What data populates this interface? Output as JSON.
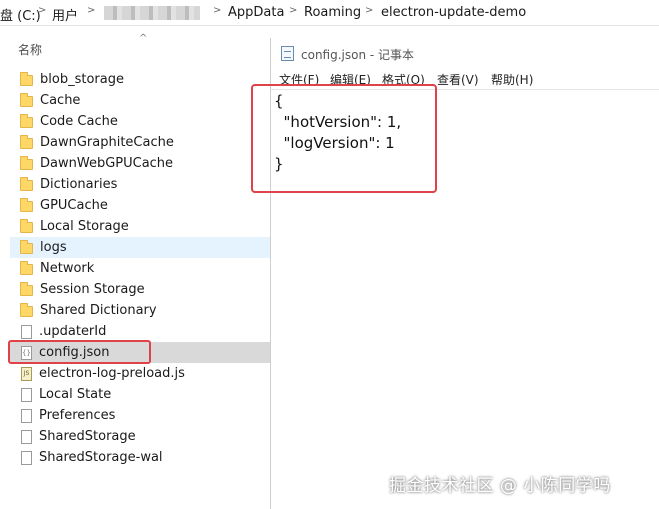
{
  "addressbar": {
    "drive": "盘 (C:)",
    "users": "用户",
    "appdata": "AppData",
    "roaming": "Roaming",
    "folder": "electron-update-demo",
    "separator": ">"
  },
  "explorer": {
    "column_name": "名称",
    "sort_arrow": "^",
    "files": [
      {
        "name": "blob_storage",
        "type": "folder"
      },
      {
        "name": "Cache",
        "type": "folder"
      },
      {
        "name": "Code Cache",
        "type": "folder"
      },
      {
        "name": "DawnGraphiteCache",
        "type": "folder"
      },
      {
        "name": "DawnWebGPUCache",
        "type": "folder"
      },
      {
        "name": "Dictionaries",
        "type": "folder"
      },
      {
        "name": "GPUCache",
        "type": "folder"
      },
      {
        "name": "Local Storage",
        "type": "folder"
      },
      {
        "name": "logs",
        "type": "folder"
      },
      {
        "name": "Network",
        "type": "folder"
      },
      {
        "name": "Session Storage",
        "type": "folder"
      },
      {
        "name": "Shared Dictionary",
        "type": "folder"
      },
      {
        "name": ".updaterId",
        "type": "file"
      },
      {
        "name": "config.json",
        "type": "json"
      },
      {
        "name": "electron-log-preload.js",
        "type": "js"
      },
      {
        "name": "Local State",
        "type": "file"
      },
      {
        "name": "Preferences",
        "type": "file"
      },
      {
        "name": "SharedStorage",
        "type": "file"
      },
      {
        "name": "SharedStorage-wal",
        "type": "file"
      }
    ]
  },
  "notepad": {
    "title": "config.json - 记事本",
    "menu": [
      "文件(F)",
      "编辑(E)",
      "格式(O)",
      "查看(V)",
      "帮助(H)"
    ],
    "content_lines": [
      "{",
      "  \"hotVersion\": 1,",
      "  \"logVersion\": 1",
      "}"
    ]
  },
  "watermark": "掘金技术社区 @ 小陈同学吗",
  "colors": {
    "highlight": "#e0424a",
    "folder": "#ffd766",
    "selected_row": "#d9d9d9",
    "hover_row": "#e5f3ff"
  }
}
